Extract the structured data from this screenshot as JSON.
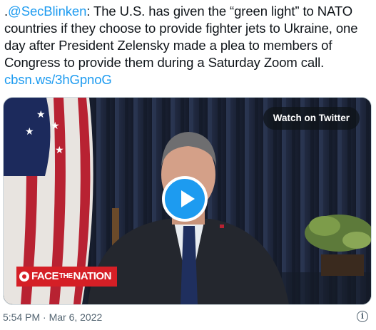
{
  "tweet": {
    "prefix": ".",
    "mention": "@SecBlinken",
    "body": ": The U.S. has given the “green light” to NATO countries if they choose to provide fighter jets to Ukraine, one day after President Zelensky made a plea to members of Congress to provide them during a Saturday Zoom call. ",
    "link": "cbsn.ws/3hGpnoG"
  },
  "media": {
    "watch_label": "Watch on Twitter",
    "show_logo_a": "FACE",
    "show_logo_the": "THE",
    "show_logo_b": "NATION"
  },
  "meta": {
    "timestamp": "5:54 PM · Mar 6, 2022"
  },
  "icons": {
    "info": "info-icon",
    "play": "play-icon"
  },
  "colors": {
    "link": "#1d9bf0",
    "play": "#1d9bf0",
    "logo_red": "#d51f26"
  }
}
